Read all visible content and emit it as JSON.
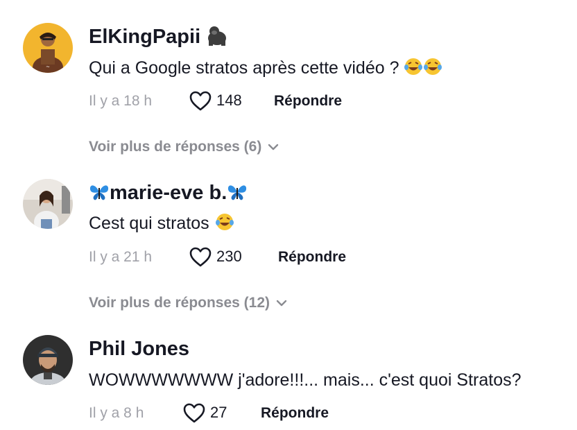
{
  "comments": [
    {
      "username": "ElKingPapii",
      "username_emoji": "gorilla-emoji",
      "text": "Qui a Google stratos après cette vidéo ?",
      "text_emoji": "laughing-tears-emoji x2",
      "time": "Il y a 18 h",
      "likes": "148",
      "reply_label": "Répondre",
      "more_replies": "Voir plus de réponses (6)",
      "avatar_colors": {
        "bg": "#f2b52e"
      }
    },
    {
      "username_prefix": "🦋",
      "username": "marie-eve b.",
      "username_suffix": "🦋",
      "text": "Cest qui stratos",
      "text_emoji": "laughing-tears-emoji",
      "time": "Il y a 21 h",
      "likes": "230",
      "reply_label": "Répondre",
      "more_replies": "Voir plus de réponses (12)",
      "avatar_colors": {
        "bg": "#d9d3cb"
      }
    },
    {
      "username": "Phil Jones",
      "text": "WOWWWWWWW j'adore!!!... mais... c'est quoi Stratos?",
      "time": "Il y a 8 h",
      "likes": "27",
      "reply_label": "Répondre",
      "avatar_colors": {
        "bg": "#3a3a3a"
      }
    }
  ],
  "colors": {
    "text_primary": "#161823",
    "text_muted": "#a0a1a8",
    "link_muted": "#8a8b91"
  }
}
